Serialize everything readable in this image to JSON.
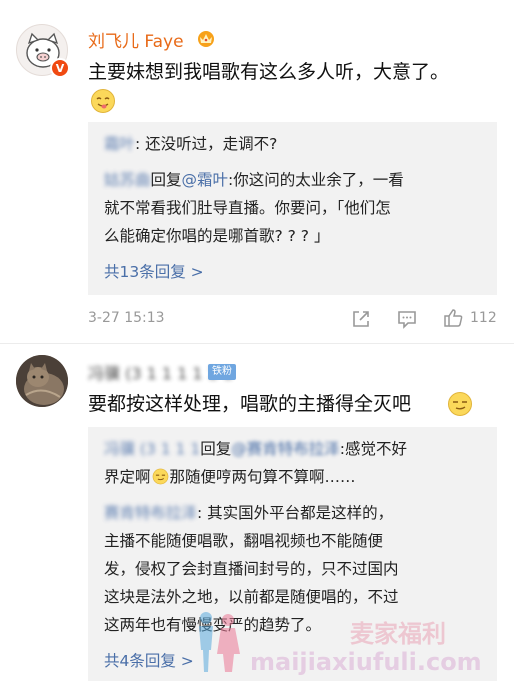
{
  "comment1": {
    "username": "刘飞儿 Faye",
    "verified_badge": "V",
    "text": "主要妹想到我唱歌有这么多人听，大意了。",
    "replies": [
      {
        "author": "霜叶",
        "text": ": 还没听过，走调不?"
      },
      {
        "author": "姑苏曲",
        "reply_word": "回复",
        "mention": "@霜叶",
        "text_line1": ":你这问的太业余了，一看",
        "text_line2": "就不常看我们肚导直播。你要问，「他们怎",
        "text_line3": "么能确定你唱的是哪首歌? ? ? 」"
      }
    ],
    "more_replies": "共13条回复 >",
    "time": "3-27 15:13",
    "like_count": "112"
  },
  "comment2": {
    "username": "冯骥 (3 1 1 1 1 1 1",
    "fan_badge": "铁粉",
    "text": "要都按这样处理，唱歌的主播得全灭吧",
    "replies": [
      {
        "author": "冯骥 (3 1 1 1",
        "reply_word": "回复",
        "mention": "@赛肯特布拉泽",
        "text_line1": ":感觉不好",
        "text_line2": "界定啊",
        "text_line2b": "那随便哼两句算不算啊……"
      },
      {
        "author": "赛肯特布拉泽",
        "text_line1": ": 其实国外平台都是这样的，",
        "text_line2": "主播不能随便唱歌，翻唱视频也不能随便",
        "text_line3": "发，侵权了会封直播间封号的，只不过国内",
        "text_line4": "这块是法外之地，以前都是随便唱的，不过",
        "text_line5": "这两年也有慢慢变严的趋势了。"
      }
    ],
    "more_replies": "共4条回复 >"
  },
  "watermark": {
    "text": "麦家福利",
    "url": "maijiaxiufuli.com"
  },
  "icons": {
    "share": "share-icon",
    "comment": "comment-icon",
    "like": "thumbs-up-icon"
  },
  "colors": {
    "vip_name": "#e86a18",
    "link": "#4a6fa8",
    "reply_bg": "#f2f2f2",
    "meta": "#999999"
  }
}
